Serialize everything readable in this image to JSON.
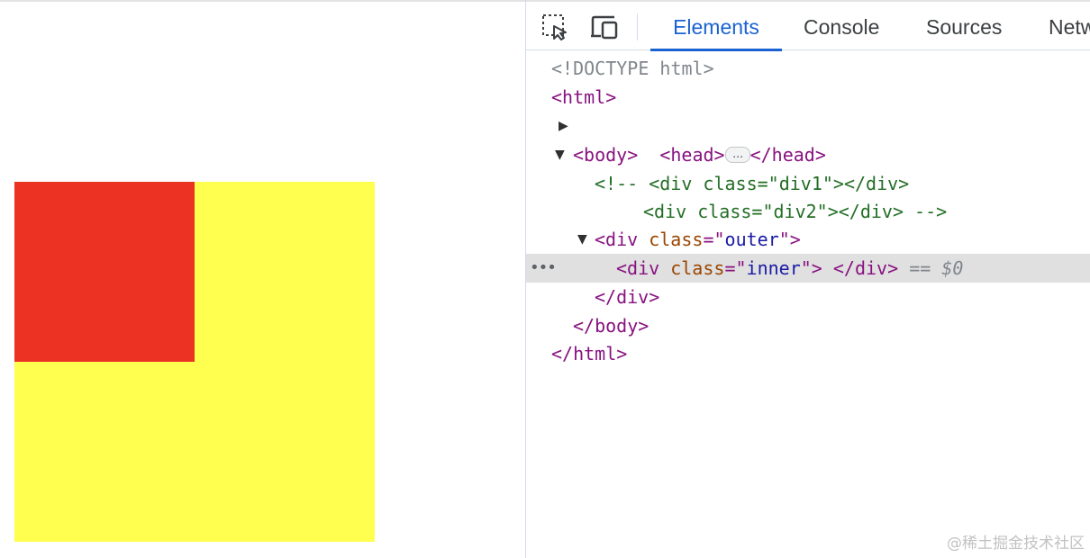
{
  "viewport": {
    "outer_color": "#ffff50",
    "inner_color": "#ec3323"
  },
  "toolbar": {
    "inspect_icon": "inspect-element-icon",
    "device_icon": "device-toolbar-icon",
    "tabs": [
      {
        "label": "Elements",
        "active": true
      },
      {
        "label": "Console",
        "active": false
      },
      {
        "label": "Sources",
        "active": false
      },
      {
        "label": "Netw",
        "active": false
      }
    ]
  },
  "dom": {
    "doctype": "<!DOCTYPE html>",
    "html_open": "<html>",
    "head_open": "<head>",
    "head_ellipsis": "…",
    "head_close": "</head>",
    "body_open": "<body>",
    "comment_line1": "<!-- <div class=\"div1\"></div>",
    "comment_line2": "<div class=\"div2\"></div> -->",
    "outer_div": {
      "open": "<div",
      "attr": "class",
      "eq_quote": "=\"",
      "value": "outer",
      "close_quote": "\">"
    },
    "inner_div": {
      "open": "<div",
      "attr": "class",
      "eq_quote": "=\"",
      "value": "inner",
      "close_quote": "\">",
      "space": " ",
      "end_tag": "</div>",
      "selection_marker": "==",
      "dollar": "$0"
    },
    "div_close": "</div>",
    "body_close": "</body>",
    "html_close": "</html>",
    "gutter": "•••"
  },
  "watermark": "@稀土掘金技术社区"
}
